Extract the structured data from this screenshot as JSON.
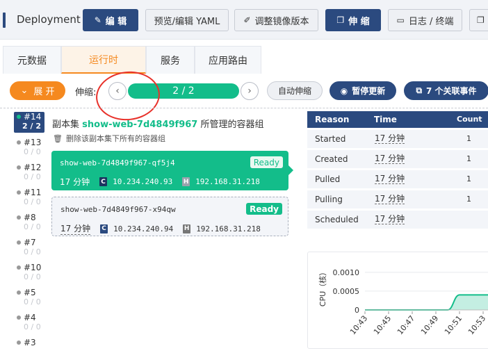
{
  "header": {
    "title": "Deployment",
    "buttons": {
      "edit": "编 辑",
      "yaml": "预览/编辑 YAML",
      "image": "调整镜像版本",
      "scale": "伸 缩",
      "logs": "日志 / 终端"
    }
  },
  "tabs": [
    "元数据",
    "运行时",
    "服务",
    "应用路由"
  ],
  "toolbar": {
    "expand": "展 开",
    "scale_label": "伸缩:",
    "scale_value": "2 / 2",
    "auto_scale": "自动伸缩",
    "pause": "暂停更新",
    "events": "7 个关联事件"
  },
  "revisions": [
    {
      "label": "#14",
      "count": "2 / 2"
    },
    {
      "label": "#13",
      "count": "0 / 0"
    },
    {
      "label": "#12",
      "count": "0 / 0"
    },
    {
      "label": "#11",
      "count": "0 / 0"
    },
    {
      "label": "#8",
      "count": "0 / 0"
    },
    {
      "label": "#7",
      "count": "0 / 0"
    },
    {
      "label": "#10",
      "count": "0 / 0"
    },
    {
      "label": "#5",
      "count": "0 / 0"
    },
    {
      "label": "#4",
      "count": "0 / 0"
    },
    {
      "label": "#3",
      "count": ""
    }
  ],
  "replica_set": {
    "prefix": "副本集",
    "name": "show-web-7d4849f967",
    "suffix": "所管理的容器组",
    "delete_all": "删除该副本集下所有的容器组"
  },
  "pods": [
    {
      "name": "show-web-7d4849f967-qf5j4",
      "status": "Ready",
      "age": "17 分钟",
      "container_ip": "10.234.240.93",
      "host_ip": "192.168.31.218"
    },
    {
      "name": "show-web-7d4849f967-x94qw",
      "status": "Ready",
      "age": "17 分钟",
      "container_ip": "10.234.240.94",
      "host_ip": "192.168.31.218"
    }
  ],
  "badges": {
    "container": "C",
    "host": "H"
  },
  "events_table": {
    "headers": {
      "reason": "Reason",
      "time": "Time",
      "count": "Count"
    },
    "rows": [
      {
        "reason": "Started",
        "time": "17 分钟",
        "count": "1"
      },
      {
        "reason": "Created",
        "time": "17 分钟",
        "count": "1"
      },
      {
        "reason": "Pulled",
        "time": "17 分钟",
        "count": "1"
      },
      {
        "reason": "Pulling",
        "time": "17 分钟",
        "count": "1"
      },
      {
        "reason": "Scheduled",
        "time": "17 分钟",
        "count": ""
      }
    ]
  },
  "chart_data": {
    "type": "area",
    "ylabel": "CPU（核）",
    "yticks": [
      "0.0010",
      "0.0005",
      "0"
    ],
    "xticks": [
      "10:43",
      "10:45",
      "10:47",
      "10:49",
      "10:51",
      "10:53"
    ],
    "ylim": [
      0,
      0.0012
    ],
    "x": [
      "10:43",
      "10:45",
      "10:47",
      "10:49",
      "10:50",
      "10:51",
      "10:52",
      "10:53",
      "10:54"
    ],
    "values": [
      0,
      0,
      0,
      0,
      0,
      0.0004,
      0.0004,
      0.0004,
      0.0004
    ],
    "color": "#13bd8a"
  },
  "colors": {
    "accent": "#2b4a7f",
    "green": "#13bd8a",
    "orange": "#f5891f",
    "red_annotation": "#e8312a"
  }
}
